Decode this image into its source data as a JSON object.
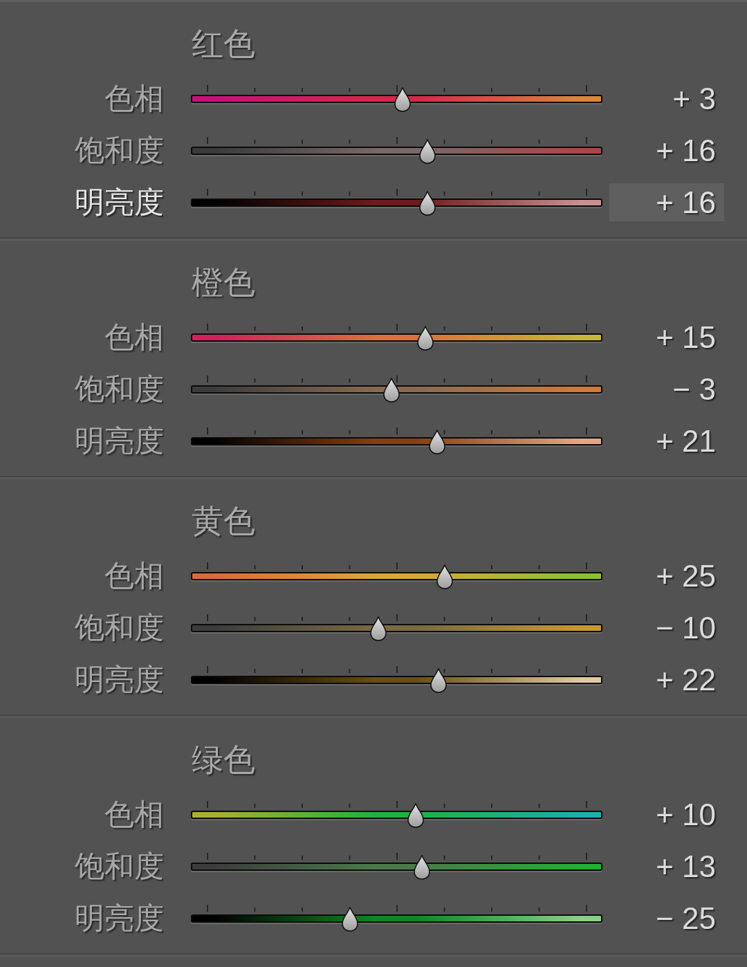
{
  "panel": {
    "sections": [
      {
        "title": "红色",
        "sliders": [
          {
            "label": "色相",
            "reading": "+ 3",
            "level": 0.515,
            "selected": false,
            "stops": [
              {
                "color": "#c4127a"
              },
              {
                "color": "#d22a4c"
              },
              {
                "color": "#d8863c"
              }
            ]
          },
          {
            "label": "饱和度",
            "reading": "+ 16",
            "level": 0.58,
            "selected": false,
            "stops": [
              {
                "color": "#3a3a3a"
              },
              {
                "color": "#7a6868"
              },
              {
                "color": "#aa4848"
              }
            ]
          },
          {
            "label": "明亮度",
            "reading": "+ 16",
            "level": 0.58,
            "selected": true,
            "stops": [
              {
                "color": "#000000"
              },
              {
                "color": "#6e1a1a"
              },
              {
                "color": "#c89090"
              }
            ]
          }
        ]
      },
      {
        "title": "橙色",
        "sliders": [
          {
            "label": "色相",
            "reading": "+ 15",
            "level": 0.575,
            "selected": false,
            "stops": [
              {
                "color": "#d81c5c"
              },
              {
                "color": "#d87040"
              },
              {
                "color": "#c8b830"
              }
            ]
          },
          {
            "label": "饱和度",
            "reading": "− 3",
            "level": 0.485,
            "selected": false,
            "stops": [
              {
                "color": "#3c3c3c"
              },
              {
                "color": "#8a6a50"
              },
              {
                "color": "#d07a3c"
              }
            ]
          },
          {
            "label": "明亮度",
            "reading": "+ 21",
            "level": 0.605,
            "selected": false,
            "stops": [
              {
                "color": "#000000"
              },
              {
                "color": "#8a3e10"
              },
              {
                "color": "#e0a888"
              }
            ]
          }
        ]
      },
      {
        "title": "黄色",
        "sliders": [
          {
            "label": "色相",
            "reading": "+ 25",
            "level": 0.625,
            "selected": false,
            "stops": [
              {
                "color": "#d86a40"
              },
              {
                "color": "#d8a838"
              },
              {
                "color": "#8ac030"
              }
            ]
          },
          {
            "label": "饱和度",
            "reading": "− 10",
            "level": 0.45,
            "selected": false,
            "stops": [
              {
                "color": "#3c3c3c"
              },
              {
                "color": "#7a6a40"
              },
              {
                "color": "#c89830"
              }
            ]
          },
          {
            "label": "明亮度",
            "reading": "+ 22",
            "level": 0.61,
            "selected": false,
            "stops": [
              {
                "color": "#000000"
              },
              {
                "color": "#6a5010"
              },
              {
                "color": "#e0c8a0"
              }
            ]
          }
        ]
      },
      {
        "title": "绿色",
        "sliders": [
          {
            "label": "色相",
            "reading": "+ 10",
            "level": 0.55,
            "selected": false,
            "stops": [
              {
                "color": "#a8b030"
              },
              {
                "color": "#20b040"
              },
              {
                "color": "#18b0b0"
              }
            ]
          },
          {
            "label": "饱和度",
            "reading": "+ 13",
            "level": 0.565,
            "selected": false,
            "stops": [
              {
                "color": "#3c3c3c"
              },
              {
                "color": "#4a7a4a"
              },
              {
                "color": "#20b030"
              }
            ]
          },
          {
            "label": "明亮度",
            "reading": "− 25",
            "level": 0.375,
            "selected": false,
            "stops": [
              {
                "color": "#000000"
              },
              {
                "color": "#108820"
              },
              {
                "color": "#88d088"
              }
            ]
          }
        ]
      }
    ]
  }
}
